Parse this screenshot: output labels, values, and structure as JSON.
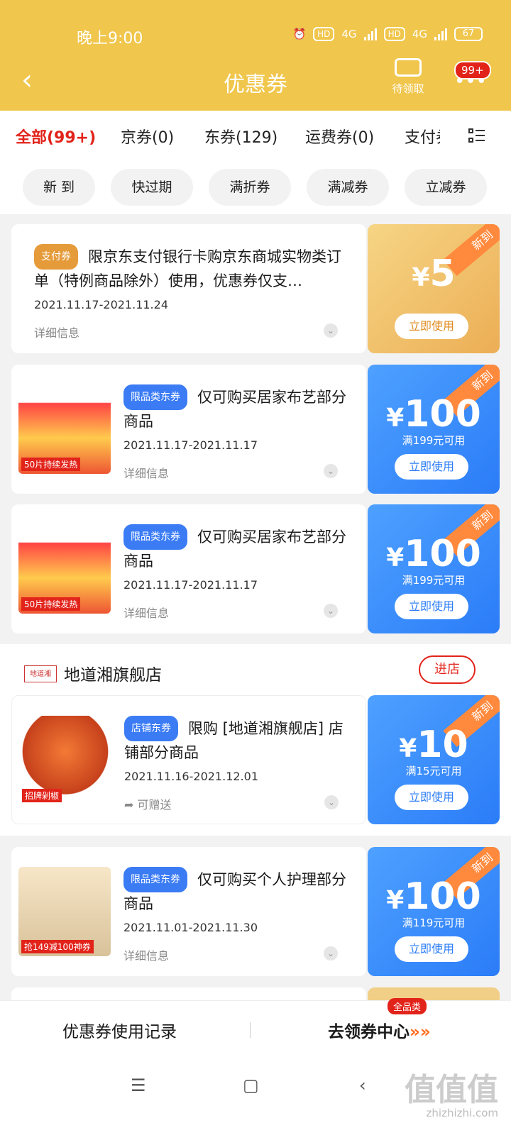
{
  "status": {
    "time": "晚上9:00",
    "net1": "4G",
    "net2": "4G",
    "hd1": "HD",
    "hd2": "HD",
    "battery": "67"
  },
  "header": {
    "title": "优惠券",
    "pending_label": "待领取",
    "badge": "99+"
  },
  "tabs": [
    "全部(99+)",
    "京券(0)",
    "东券(129)",
    "运费券(0)",
    "支付券"
  ],
  "filters": [
    "新 到",
    "快过期",
    "满折券",
    "满减券",
    "立减券"
  ],
  "coupons": [
    {
      "tag": "支付券",
      "desc": "限京东支付银行卡购京东商城实物类订单（特例商品除外）使用，优惠券仅支…",
      "date": "2021.11.17-2021.11.24",
      "detail": "详细信息",
      "new": "新到",
      "currency": "¥",
      "amount": "5",
      "cond": "",
      "button": "立即使用"
    },
    {
      "tag": "限品类东券",
      "desc": "仅可购买居家布艺部分商品",
      "date": "2021.11.17-2021.11.17",
      "detail": "详细信息",
      "new": "新到",
      "currency": "¥",
      "amount": "100",
      "cond": "满199元可用",
      "button": "立即使用"
    },
    {
      "tag": "限品类东券",
      "desc": "仅可购买居家布艺部分商品",
      "date": "2021.11.17-2021.11.17",
      "detail": "详细信息",
      "new": "新到",
      "currency": "¥",
      "amount": "100",
      "cond": "满199元可用",
      "button": "立即使用"
    },
    {
      "tag": "店铺东券",
      "desc": "限购 [地道湘旗舰店] 店铺部分商品",
      "date": "2021.11.16-2021.12.01",
      "detail": "可赠送",
      "new": "新到",
      "currency": "¥",
      "amount": "10",
      "cond": "满15元可用",
      "button": "立即使用"
    },
    {
      "tag": "限品类东券",
      "desc": "仅可购买个人护理部分商品",
      "date": "2021.11.01-2021.11.30",
      "detail": "详细信息",
      "new": "新到",
      "currency": "¥",
      "amount": "100",
      "cond": "满119元可用",
      "button": "立即使用"
    }
  ],
  "shop": {
    "name": "地道湘旗舰店",
    "logo": "地道湘",
    "enter": "进店"
  },
  "thumbs": {
    "warm_sticker": "50片持续发热",
    "chili_sticker": "招牌剁椒",
    "shampoo_sticker": "抢149减100神券"
  },
  "bottom": {
    "record": "优惠券使用记录",
    "center": "去领券中心",
    "arrows": "»»",
    "allcat": "全品类"
  },
  "watermark": {
    "text": "值值值",
    "url": "zhizhizhi.com"
  }
}
